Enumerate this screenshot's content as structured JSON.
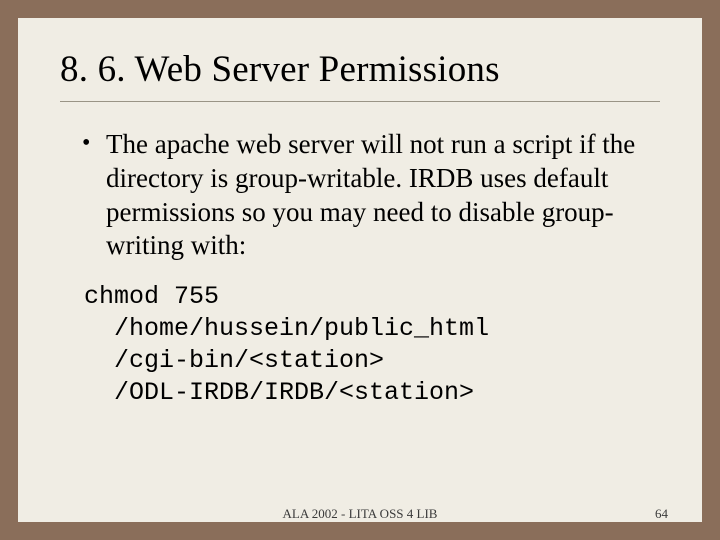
{
  "title": "8. 6. Web Server Permissions",
  "bullet1": "The apache web server will not run a script if the directory is group-writable. IRDB uses default permissions so you may need to disable group-writing with:",
  "code": "chmod 755\n  /home/hussein/public_html\n  /cgi-bin/<station>\n  /ODL-IRDB/IRDB/<station>",
  "footer": {
    "center": "ALA 2002 - LITA OSS 4 LIB",
    "page": "64"
  }
}
